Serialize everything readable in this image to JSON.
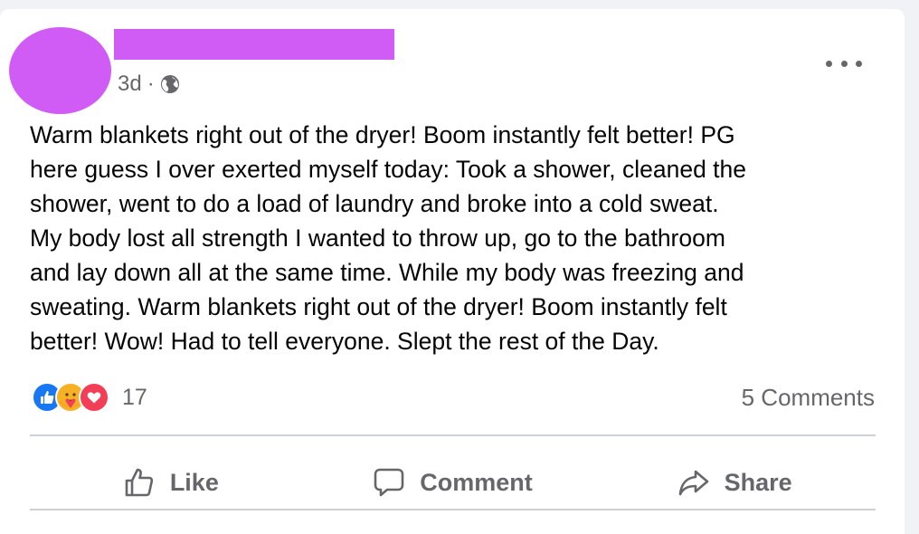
{
  "post": {
    "avatar_color": "#d05cf5",
    "name_redaction_color": "#d05cf5",
    "time": "3d",
    "separator": "·",
    "audience_icon": "globe-icon",
    "more_icon": "more-options-icon",
    "text": "Warm blankets right out of the dryer! Boom instantly felt better! PG\nhere  guess I over exerted myself today: Took a shower, cleaned the\nshower, went to do a load of laundry and broke into a cold sweat.\nMy body lost all strength  I wanted to throw up, go to the bathroom\nand lay down all at the same time. While my body was freezing and\nsweating.   Warm blankets right out of the dryer! Boom instantly felt\nbetter! Wow! Had to tell everyone. Slept the rest of the Day."
  },
  "reactions": {
    "icons": [
      "like-reaction-icon",
      "care-reaction-icon",
      "love-reaction-icon"
    ],
    "count": "17",
    "comments": "5 Comments"
  },
  "actions": {
    "like": "Like",
    "comment": "Comment",
    "share": "Share"
  },
  "colors": {
    "like_blue": "#1877f2",
    "love_red": "#f33e58",
    "care_yellow": "#f7b125",
    "secondary_text": "#65676b"
  }
}
